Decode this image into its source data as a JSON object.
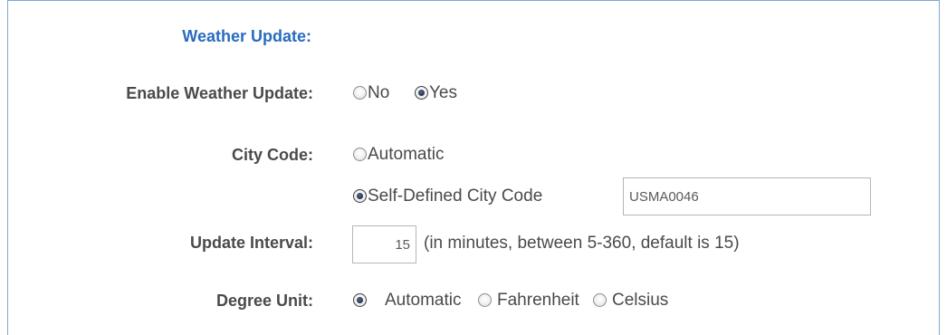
{
  "section": {
    "title": "Weather Update:"
  },
  "enable_weather_update": {
    "label": "Enable Weather Update:",
    "options": [
      {
        "label": "No",
        "selected": false
      },
      {
        "label": "Yes",
        "selected": true
      }
    ]
  },
  "city_code": {
    "label": "City Code:",
    "options": [
      {
        "label": "Automatic",
        "selected": false
      },
      {
        "label": "Self-Defined City Code",
        "selected": true
      }
    ],
    "value": "USMA0046"
  },
  "update_interval": {
    "label": "Update Interval:",
    "value": "15",
    "hint": "(in minutes, between 5-360, default is 15)"
  },
  "degree_unit": {
    "label": "Degree Unit:",
    "options": [
      {
        "label": "Automatic",
        "selected": true
      },
      {
        "label": "Fahrenheit",
        "selected": false
      },
      {
        "label": "Celsius",
        "selected": false
      }
    ]
  },
  "colors": {
    "section_title": "#2a6bbf",
    "label": "#4a4a4a",
    "frame_border": "#7fa6cf"
  }
}
